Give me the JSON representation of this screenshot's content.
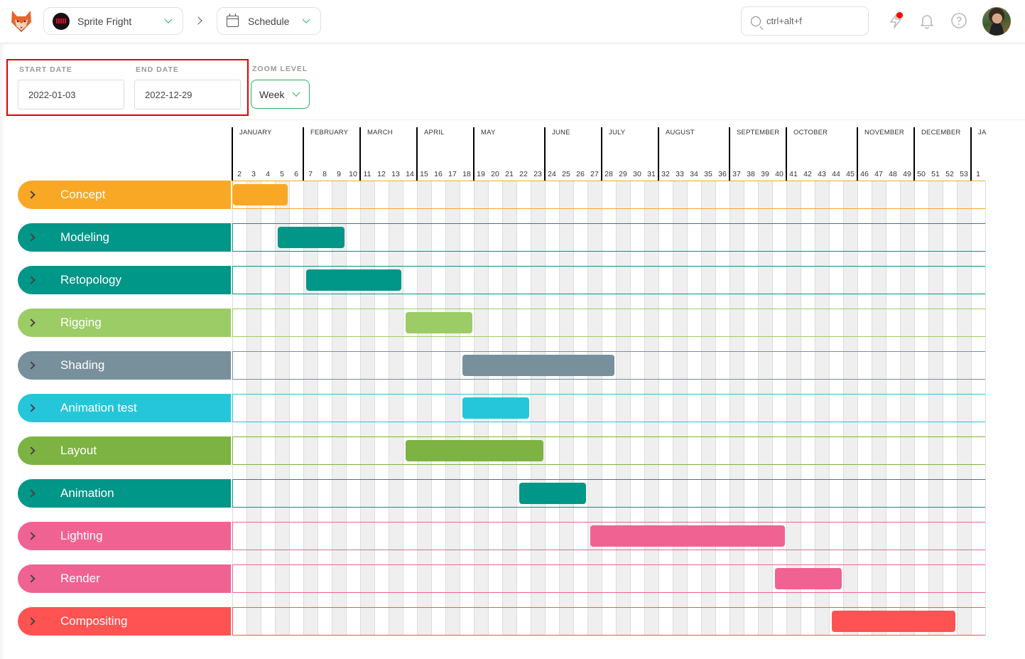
{
  "topbar": {
    "logo": "kitsu-fox-logo",
    "production": "Sprite Fright",
    "page": "Schedule",
    "search_placeholder": "ctrl+alt+f",
    "news_has_notification": true
  },
  "filters": {
    "start_date_label": "START DATE",
    "start_date": "2022-01-03",
    "end_date_label": "END DATE",
    "end_date": "2022-12-29",
    "zoom_label": "ZOOM LEVEL",
    "zoom_value": "Week"
  },
  "timeline": {
    "months": [
      {
        "label": "JANUARY",
        "first_week_index": 0
      },
      {
        "label": "FEBRUARY",
        "first_week_index": 5
      },
      {
        "label": "MARCH",
        "first_week_index": 9
      },
      {
        "label": "APRIL",
        "first_week_index": 13
      },
      {
        "label": "MAY",
        "first_week_index": 17
      },
      {
        "label": "JUNE",
        "first_week_index": 22
      },
      {
        "label": "JULY",
        "first_week_index": 26
      },
      {
        "label": "AUGUST",
        "first_week_index": 30
      },
      {
        "label": "SEPTEMBER",
        "first_week_index": 35
      },
      {
        "label": "OCTOBER",
        "first_week_index": 39
      },
      {
        "label": "NOVEMBER",
        "first_week_index": 44
      },
      {
        "label": "DECEMBER",
        "first_week_index": 48
      },
      {
        "label": "JA",
        "first_week_index": 52
      }
    ],
    "weeks": [
      "2",
      "3",
      "4",
      "5",
      "6",
      "7",
      "8",
      "9",
      "10",
      "11",
      "12",
      "13",
      "14",
      "15",
      "16",
      "17",
      "18",
      "19",
      "20",
      "21",
      "22",
      "23",
      "24",
      "25",
      "26",
      "27",
      "28",
      "29",
      "30",
      "31",
      "32",
      "33",
      "34",
      "35",
      "36",
      "37",
      "38",
      "39",
      "40",
      "41",
      "42",
      "43",
      "44",
      "45",
      "46",
      "47",
      "48",
      "49",
      "50",
      "51",
      "52",
      "53",
      "1"
    ]
  },
  "tasks": [
    {
      "name": "Concept",
      "color": "#f9a825",
      "start_week": 0.0,
      "end_week": 4.0
    },
    {
      "name": "Modeling",
      "color": "#009688",
      "start_week": 3.15,
      "end_week": 8.0
    },
    {
      "name": "Retopology",
      "color": "#009688",
      "start_week": 5.15,
      "end_week": 12.0
    },
    {
      "name": "Rigging",
      "color": "#9ccc65",
      "start_week": 12.15,
      "end_week": 17.0
    },
    {
      "name": "Shading",
      "color": "#78909c",
      "start_week": 16.15,
      "end_week": 27.0
    },
    {
      "name": "Animation test",
      "color": "#26c6da",
      "start_week": 16.15,
      "end_week": 21.0
    },
    {
      "name": "Layout",
      "color": "#7cb342",
      "start_week": 12.15,
      "end_week": 22.0
    },
    {
      "name": "Animation",
      "color": "#009688",
      "start_week": 20.15,
      "end_week": 25.0
    },
    {
      "name": "Lighting",
      "color": "#f06292",
      "start_week": 25.15,
      "end_week": 39.0
    },
    {
      "name": "Render",
      "color": "#f06292",
      "start_week": 38.15,
      "end_week": 43.0
    },
    {
      "name": "Compositing",
      "color": "#ff5252",
      "start_week": 42.15,
      "end_week": 51.0
    }
  ]
}
